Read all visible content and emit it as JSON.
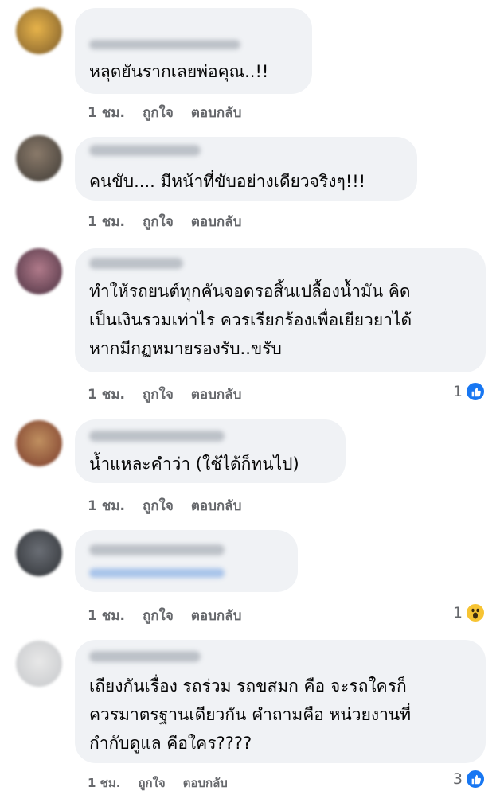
{
  "colors": {
    "bubble": "#f0f2f5",
    "meta": "#65676b",
    "like": "#1877f2",
    "wow": "#f7c433"
  },
  "comments": [
    {
      "text_lines": [
        "หลุดยันรากเลยพ่อคุณ..!!"
      ],
      "time": "1 ชม.",
      "like": "ถูกใจ",
      "reply": "ตอบกลับ",
      "reaction_count": "",
      "reaction_icon": ""
    },
    {
      "text_lines": [
        "คนขับ.... มีหน้าที่ขับอย่างเดียวจริงๆ!!!"
      ],
      "time": "1 ชม.",
      "like": "ถูกใจ",
      "reply": "ตอบกลับ",
      "reaction_count": "",
      "reaction_icon": ""
    },
    {
      "text_lines": [
        "ทำให้รถยนต์ทุกคันจอดรอสิ้นเปลื้องน้ำมัน คิด",
        "เป็นเงินรวมเท่าไร ควรเรียกร้องเพื่อเยียวยาได้",
        "หากมีกฏหมายรองรับ..ขรับ"
      ],
      "time": "1 ชม.",
      "like": "ถูกใจ",
      "reply": "ตอบกลับ",
      "reaction_count": "1",
      "reaction_icon": "like-icon"
    },
    {
      "text_lines": [
        "น้ำแหละคำว่า (ใช้ได้ก็ทนไป)"
      ],
      "time": "1 ชม.",
      "like": "ถูกใจ",
      "reply": "ตอบกลับ",
      "reaction_count": "",
      "reaction_icon": ""
    },
    {
      "text_lines": [],
      "time": "1 ชม.",
      "like": "ถูกใจ",
      "reply": "ตอบกลับ",
      "reaction_count": "1",
      "reaction_icon": "wow-icon"
    },
    {
      "text_lines": [
        "เถียงกันเรื่อง รถร่วม รถขสมก คือ จะรถใครก็",
        "ควรมาตรฐานเดียวกัน คำถามคือ หน่วยงานที่",
        "กำกับดูแล คือใคร????"
      ],
      "time": "1 ชม.",
      "like": "ถูกใจ",
      "reply": "ตอบกลับ",
      "reaction_count": "3",
      "reaction_icon": "like-icon"
    }
  ]
}
